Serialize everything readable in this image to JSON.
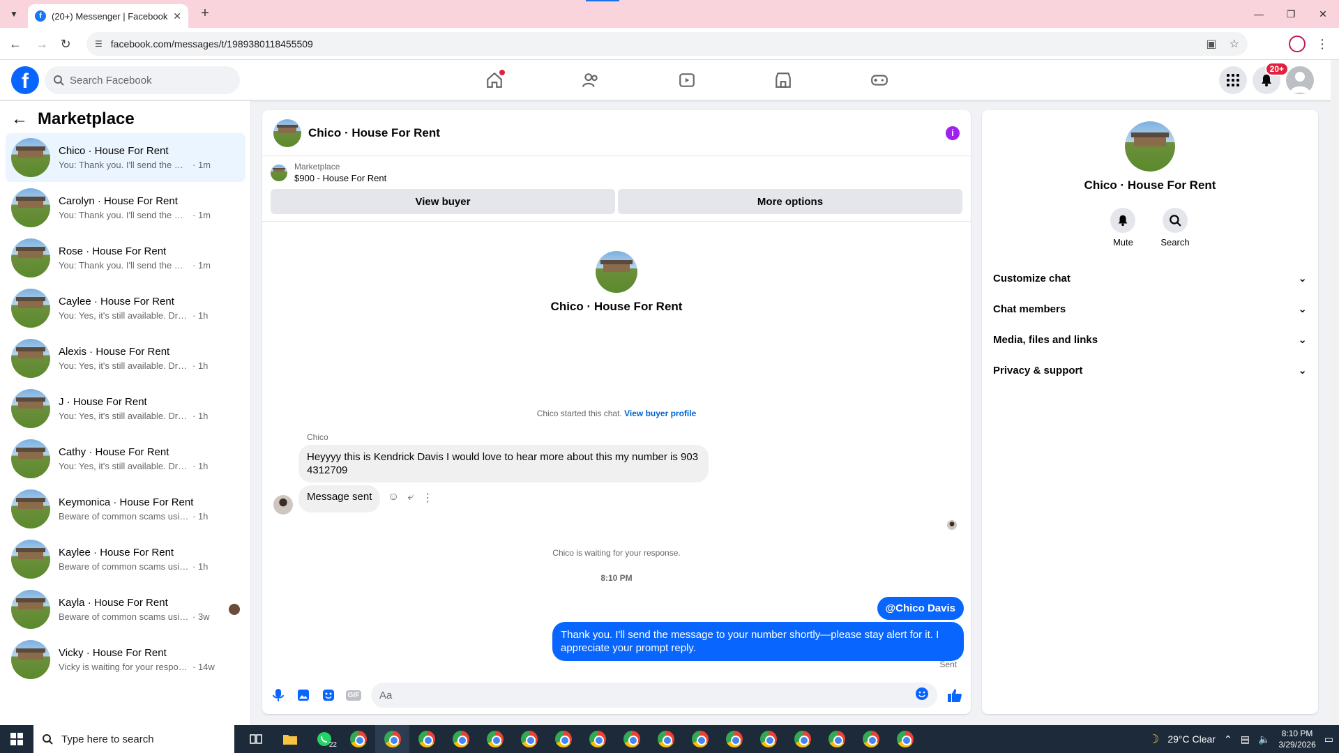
{
  "browser": {
    "tab_title": "(20+) Messenger | Facebook",
    "url": "facebook.com/messages/t/1989380118455509"
  },
  "fb": {
    "search_placeholder": "Search Facebook",
    "notif_badge": "20+"
  },
  "sidebar": {
    "title": "Marketplace",
    "conversations": [
      {
        "name": "Chico · House For Rent",
        "preview": "You: Thank you. I'll send the message...",
        "time": "· 1m"
      },
      {
        "name": "Carolyn · House For Rent",
        "preview": "You: Thank you. I'll send the message...",
        "time": "· 1m"
      },
      {
        "name": "Rose · House For Rent",
        "preview": "You: Thank you. I'll send the message...",
        "time": "· 1m"
      },
      {
        "name": "Caylee · House For Rent",
        "preview": "You: Yes, it's still available. Drop me y...",
        "time": "· 1h"
      },
      {
        "name": "Alexis · House For Rent",
        "preview": "You: Yes, it's still available. Drop me y...",
        "time": "· 1h"
      },
      {
        "name": "J · House For Rent",
        "preview": "You: Yes, it's still available. Drop me y...",
        "time": "· 1h"
      },
      {
        "name": "Cathy · House For Rent",
        "preview": "You: Yes, it's still available. Drop me y...",
        "time": "· 1h"
      },
      {
        "name": "Keymonica · House For Rent",
        "preview": "Beware of common scams using pay...",
        "time": "· 1h"
      },
      {
        "name": "Kaylee · House For Rent",
        "preview": "Beware of common scams using pay...",
        "time": "· 1h"
      },
      {
        "name": "Kayla · House For Rent",
        "preview": "Beware of common scams using p...",
        "time": "· 3w"
      },
      {
        "name": "Vicky · House For Rent",
        "preview": "Vicky is waiting for your response.",
        "time": "· 14w"
      }
    ]
  },
  "chat": {
    "title": "Chico · House For Rent",
    "listing_label": "Marketplace",
    "listing_price": "$900 - House For Rent",
    "view_buyer": "View buyer",
    "more_options": "More options",
    "intro_name": "Chico · House For Rent",
    "started_text": "Chico started this chat.",
    "view_profile": "View buyer profile",
    "sender": "Chico",
    "msg_in": "Heyyyy this is Kendrick Davis I would love to hear more about this my number is 903 4312709",
    "msg_in2": "Message sent",
    "waiting": "Chico is waiting for your response.",
    "timestamp": "8:10 PM",
    "mention": "@Chico Davis",
    "msg_out": "Thank you. I'll send the message to your number shortly—please stay alert for it. I appreciate your prompt reply.",
    "sent": "Sent",
    "composer_placeholder": "Aa",
    "gif": "GIF"
  },
  "rpanel": {
    "name": "Chico · House For Rent",
    "mute": "Mute",
    "search": "Search",
    "sections": [
      "Customize chat",
      "Chat members",
      "Media, files and links",
      "Privacy & support"
    ]
  },
  "taskbar": {
    "search_placeholder": "Type here to search",
    "whatsapp_badge": "22",
    "weather": "29°C  Clear",
    "time": "8:10 PM",
    "date": "3/29/2026"
  },
  "colors": {
    "accent": "#0866ff",
    "bubble_in": "#f0f0f0",
    "info": "#a020f0"
  }
}
